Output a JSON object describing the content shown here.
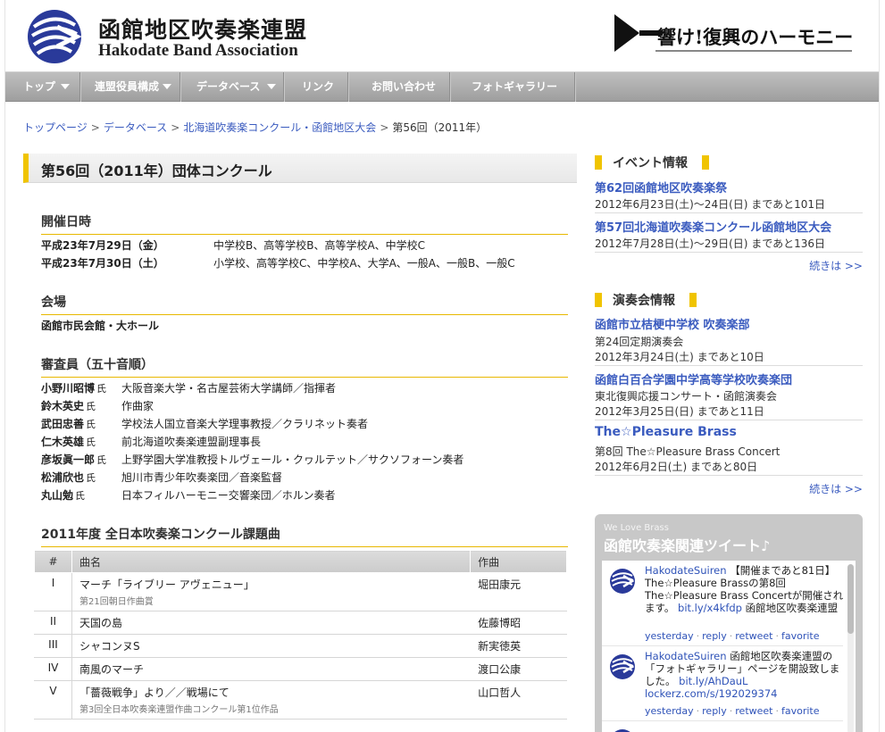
{
  "header": {
    "title_ja": "函館地区吹奏楽連盟",
    "title_en": "Hakodate Band Association",
    "banner_text": "響け!復興のハーモニー"
  },
  "nav": {
    "items": [
      {
        "label": "トップ",
        "dropdown": true
      },
      {
        "label": "連盟役員構成",
        "dropdown": true
      },
      {
        "label": "データベース",
        "dropdown": true
      },
      {
        "label": "リンク",
        "dropdown": false
      },
      {
        "label": "お問い合わせ",
        "dropdown": false
      },
      {
        "label": "フォトギャラリー",
        "dropdown": false
      }
    ]
  },
  "breadcrumb": {
    "items": [
      "トップページ",
      "データベース",
      "北海道吹奏楽コンクール・函館地区大会"
    ],
    "current": "第56回（2011年）",
    "separator": ">"
  },
  "main": {
    "heading": "第56回（2011年）団体コンクール",
    "schedule": {
      "title": "開催日時",
      "rows": [
        {
          "date": "平成23年7月29日（金）",
          "groups": "中学校B、高等学校B、高等学校A、中学校C"
        },
        {
          "date": "平成23年7月30日（土）",
          "groups": "小学校、高等学校C、中学校A、大学A、一般A、一般B、一般C"
        }
      ]
    },
    "venue": {
      "title": "会場",
      "name": "函館市民会館・大ホール"
    },
    "judges": {
      "title": "審査員（五十音順）",
      "honorific": "氏",
      "rows": [
        {
          "name": "小野川昭博",
          "desc": "大阪音楽大学・名古屋芸術大学講師／指揮者"
        },
        {
          "name": "鈴木英史",
          "desc": "作曲家"
        },
        {
          "name": "武田忠善",
          "desc": "学校法人国立音楽大学理事教授／クラリネット奏者"
        },
        {
          "name": "仁木英雄",
          "desc": "前北海道吹奏楽連盟副理事長"
        },
        {
          "name": "彦坂眞一郎",
          "desc": "上野学園大学准教授トルヴェール・クヮルテット／サクソフォーン奏者"
        },
        {
          "name": "松浦欣也",
          "desc": "旭川市青少年吹奏楽団／音楽監督"
        },
        {
          "name": "丸山勉",
          "desc": "日本フィルハーモニー交響楽団／ホルン奏者"
        }
      ]
    },
    "pieces": {
      "title": "2011年度 全日本吹奏楽コンクール課題曲",
      "headers": [
        "#",
        "曲名",
        "作曲"
      ],
      "rows": [
        {
          "num": "I",
          "title": "マーチ「ライブリー アヴェニュー」",
          "note": "第21回朝日作曲賞",
          "composer": "堀田康元"
        },
        {
          "num": "II",
          "title": "天国の島",
          "note": "",
          "composer": "佐藤博昭"
        },
        {
          "num": "III",
          "title": "シャコンヌS",
          "note": "",
          "composer": "新実徳英"
        },
        {
          "num": "IV",
          "title": "南風のマーチ",
          "note": "",
          "composer": "渡口公康"
        },
        {
          "num": "V",
          "title": "「薔薇戦争」より／／戦場にて",
          "note": "第3回全日本吹奏楽連盟作曲コンクール第1位作品",
          "composer": "山口哲人"
        }
      ]
    }
  },
  "sidebar": {
    "events": {
      "title": "イベント情報",
      "items": [
        {
          "title": "第62回函館地区吹奏楽祭",
          "date": "2012年6月23日(土)〜24日(日) まであと101日"
        },
        {
          "title": "第57回北海道吹奏楽コンクール函館地区大会",
          "date": "2012年7月28日(土)〜29日(日) まであと136日"
        }
      ],
      "more": "続きは >>"
    },
    "concerts": {
      "title": "演奏会情報",
      "items": [
        {
          "title": "函館市立桔梗中学校 吹奏楽部",
          "sub": "第24回定期演奏会",
          "date": "2012年3月24日(土) まであと10日"
        },
        {
          "title": "函館白百合学園中学高等学校吹奏楽団",
          "sub": "東北復興応援コンサート・函館演奏会",
          "date": "2012年3月25日(日) まであと11日"
        },
        {
          "title": "The☆Pleasure Brass",
          "sub": "第8回 The☆Pleasure Brass Concert",
          "date": "2012年6月2日(土) まであと80日"
        }
      ],
      "more": "続きは >>"
    },
    "twitter": {
      "kicker": "We Love Brass",
      "title": "函館吹奏楽関連ツイート♪",
      "tweets": [
        {
          "user": "HakodateSuiren",
          "text": "【開催まであと81日】The☆Pleasure Brassの第8回The☆Pleasure Brass Concertが開催されます。",
          "link": "bit.ly/x4kfdp",
          "tail": "函館地区吹奏楽連盟",
          "actions": [
            "yesterday",
            "reply",
            "retweet",
            "favorite"
          ]
        },
        {
          "user": "HakodateSuiren",
          "text": "函館地区吹奏楽連盟の「フォトギャラリー」ページを開設致しました。",
          "link": "bit.ly/AhDauL lockerz.com/s/192029374",
          "tail": "",
          "actions": [
            "yesterday",
            "reply",
            "retweet",
            "favorite"
          ]
        }
      ]
    }
  },
  "colors": {
    "accent": "#f0c400",
    "link": "#3a5bbf",
    "nav": "#a8a8a8"
  }
}
